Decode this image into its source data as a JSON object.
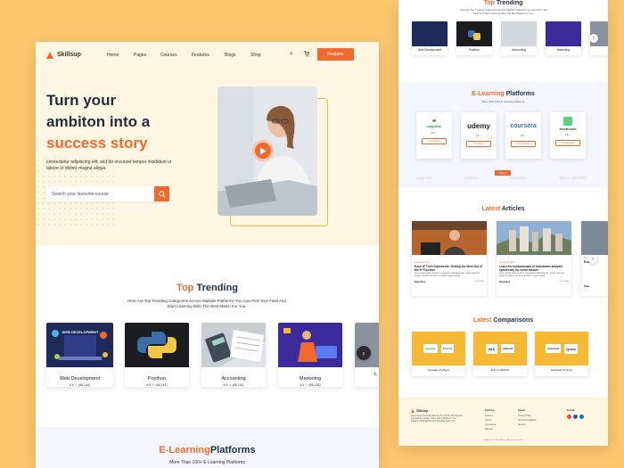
{
  "brand": {
    "name": "Skillsup",
    "accent": "#f16a2d",
    "bg": "#fbc66e",
    "yellow": "#f5b934"
  },
  "nav": {
    "home": "Home",
    "pages": "Pages",
    "courses": "Courses",
    "features": "Features",
    "blogs": "Blogs",
    "shop": "Shop",
    "register": "Register"
  },
  "hero": {
    "line1": "Turn your",
    "line2": "ambiton into a",
    "line3": "success story",
    "sub": "consectetur adipiscing elit, sed do eiusmod tempor incididunt ut labore et dolore magna aliqua.",
    "search_placeholder": "Search your favourite course"
  },
  "trending": {
    "title_a": "Top",
    "title_b": "Trending",
    "sub": "Here Are Top Trending Categories Across Multiple Platforms You Can Pick Your Field And Start Learning With The Best Match For You.",
    "cards": [
      {
        "name": "Web Development",
        "rating": "4.5",
        "reviews": "(66,144)",
        "badge": "WEB DEVELOPMENT"
      },
      {
        "name": "Poython",
        "rating": "4.5",
        "reviews": "(66,144)"
      },
      {
        "name": "Accounting",
        "rating": "4.5",
        "reviews": "(66,144)"
      },
      {
        "name": "Marketing",
        "rating": "4.5",
        "reviews": "(66,144)"
      },
      {
        "name": "L",
        "rating": "",
        "reviews": ""
      }
    ]
  },
  "platforms": {
    "title_a": "E-Learning",
    "title_b": "Platforms",
    "sub": "More Than 100+ E Learning Platforms",
    "cards": [
      {
        "name": "upgrade",
        "rating": "4.8",
        "btn": "For Upgrade"
      },
      {
        "name": "udemy",
        "rating": "4.8",
        "btn": "For Udemy"
      },
      {
        "name": "coursera",
        "rating": "4.8",
        "btn": "For Coursera"
      },
      {
        "name": "treehouse",
        "rating": "4.8",
        "btn": "For Treehouse"
      }
    ],
    "see_all": "See All",
    "faded": [
      "upgrade",
      "Udemy",
      "coursera",
      "SKILL SHARE"
    ]
  },
  "articles": {
    "title_a": "Latest",
    "title_b": "Articles",
    "items": [
      {
        "tag": "Investment Tips",
        "title": "Excel IF Then Statements: Getting the Most Out of the IF Function",
        "excerpt": "Lorem ipsum dolor sit amet, consectetur adipiscing elit, sed do eiusmod tempor incididunt ut labore et dolore magna aliqua.",
        "read": "Read More",
        "date": "1 min ago"
      },
      {
        "tag": "Investment Tips",
        "title": "Learn the fundamentals of investment analysis specifically for rental income",
        "excerpt": "Lorem ipsum dolor sit amet, consectetur adipiscing elit, sed do eiusmod tempor incididunt ut labore et dolore magna aliqua.",
        "read": "Read More",
        "date": "1 min ago"
      },
      {
        "tag": "Exc",
        "title": "Exce",
        "excerpt": "",
        "read": "Read",
        "date": ""
      }
    ]
  },
  "comparisons": {
    "title_a": "Latest",
    "title_b": "Comparisons",
    "items": [
      {
        "a": "upgrade",
        "b": "BYJU'S",
        "label": "Upgrade VS Byju's"
      },
      {
        "a": "edX",
        "b": "skillsoft",
        "label": "Edx vs Skillsoft"
      },
      {
        "a": "Sainsaad",
        "b": "Qurio",
        "label": "Sainsaad vs Qurio"
      }
    ]
  },
  "footer": {
    "brand": "Skillsup",
    "about": "Lorem Ipsum Is Simply Dummy Text Of The Printing And Typesetting Industry. Lorem Ipsum Has Been The Industry's Standard Dummy Text Ever Since The",
    "cols": [
      {
        "head": "Explore",
        "links": [
          "Courses",
          "Articles",
          "Comparison",
          "Sitemap"
        ]
      },
      {
        "head": "About",
        "links": [
          "Privacy Policy",
          "Terms & Conditions",
          "Support"
        ]
      },
      {
        "head": "Social",
        "links": []
      }
    ],
    "copyright": "Copyright © 2023 Skillsup. All rights reserved."
  }
}
